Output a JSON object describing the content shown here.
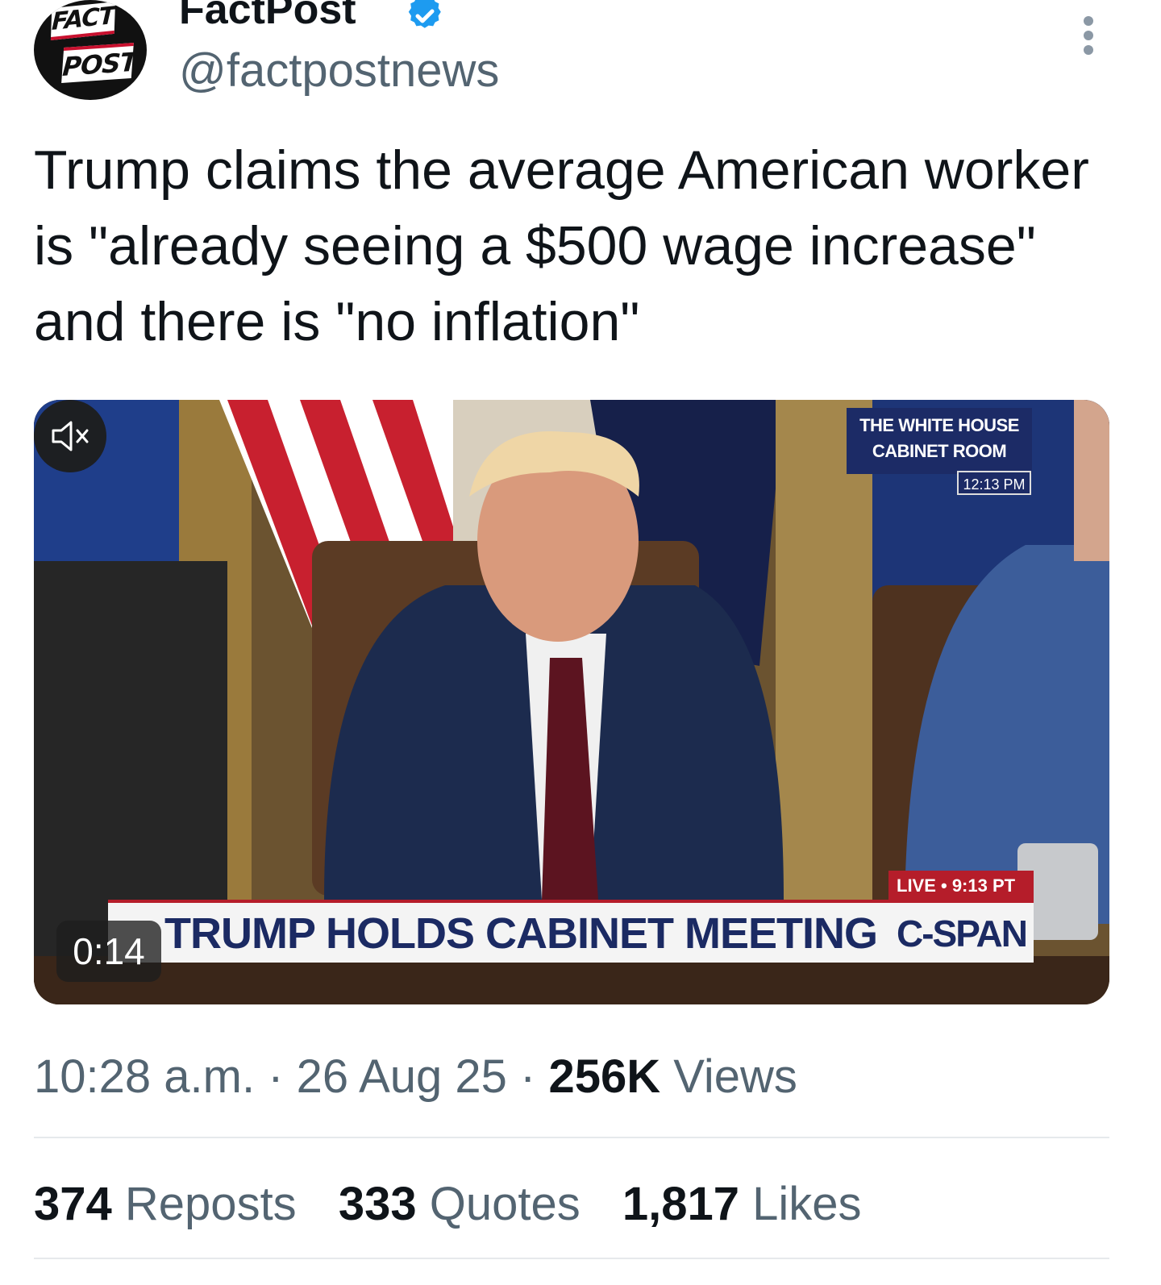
{
  "account": {
    "display_name": "FactPost",
    "handle": "@factpostnews",
    "avatar_text_line1": "FACT",
    "avatar_text_line2": "POST",
    "verified_icon": "verified-badge-icon",
    "verified_color": "#1d9bf0"
  },
  "tweet": {
    "text": "Trump claims the average American worker is \"already seeing a $500 wage increase\" and there is \"no inflation\""
  },
  "video": {
    "overlay_location_line1": "THE WHITE HOUSE",
    "overlay_location_line2": "CABINET ROOM",
    "overlay_local_time": "12:13 PM",
    "lower_third_title": "TRUMP HOLDS CABINET MEETING",
    "live_label": "LIVE • 9:13 PT",
    "network_label": "C-SPAN",
    "duration": "0:14",
    "mute_icon": "speaker-muted-icon"
  },
  "meta": {
    "time": "10:28 a.m.",
    "separator": "·",
    "date": "26 Aug 25",
    "views_count": "256K",
    "views_label": "Views"
  },
  "stats": {
    "reposts_count": "374",
    "reposts_label": "Reposts",
    "quotes_count": "333",
    "quotes_label": "Quotes",
    "likes_count": "1,817",
    "likes_label": "Likes"
  },
  "colors": {
    "text_primary": "#0f1419",
    "text_secondary": "#536471",
    "divider": "#e6e9ec"
  }
}
